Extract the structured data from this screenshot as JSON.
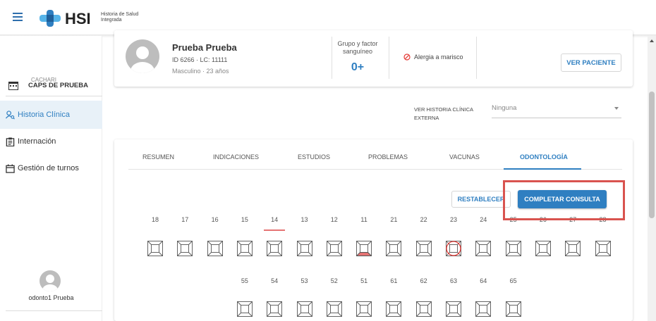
{
  "app": {
    "logo_text": "HSI",
    "logo_subtitle_line1": "Historia de Salud",
    "logo_subtitle_line2": "Integrada"
  },
  "sidebar": {
    "institution_name": "CAPS DE PRUEBA",
    "institution_location": "CACHARI",
    "items": [
      {
        "label": "Historia Clínica",
        "icon": "patient-search-icon",
        "active": true
      },
      {
        "label": "Internación",
        "icon": "clipboard-icon",
        "active": false
      },
      {
        "label": "Gestión de turnos",
        "icon": "calendar-icon",
        "active": false
      }
    ],
    "user_name": "odonto1 Prueba"
  },
  "patient": {
    "name": "Prueba Prueba",
    "ids": "ID 6266 · LC: 11111",
    "details": "Masculino · 23 años",
    "blood_label": "Grupo y factor sanguíneo",
    "blood_value": "0+",
    "allergy": "Alergia a marisco",
    "view_button": "VER PACIENTE"
  },
  "external_history": {
    "label_line1": "VER HISTORIA CLÍNICA",
    "label_line2": "EXTERNA",
    "selected": "Ninguna"
  },
  "tabs": [
    {
      "label": "RESUMEN",
      "active": false
    },
    {
      "label": "INDICACIONES",
      "active": false
    },
    {
      "label": "ESTUDIOS",
      "active": false
    },
    {
      "label": "PROBLEMAS",
      "active": false
    },
    {
      "label": "VACUNAS",
      "active": false
    },
    {
      "label": "ODONTOLOGÍA",
      "active": true
    }
  ],
  "odontogram": {
    "reset_button": "RESTABLECER",
    "complete_button": "COMPLETAR CONSULTA",
    "selected_tooth": "14",
    "permanent_teeth": [
      {
        "number": "18",
        "state": "none"
      },
      {
        "number": "17",
        "state": "none"
      },
      {
        "number": "16",
        "state": "none"
      },
      {
        "number": "15",
        "state": "none"
      },
      {
        "number": "14",
        "state": "none"
      },
      {
        "number": "13",
        "state": "none"
      },
      {
        "number": "12",
        "state": "none"
      },
      {
        "number": "11",
        "state": "bottom-red"
      },
      {
        "number": "21",
        "state": "none"
      },
      {
        "number": "22",
        "state": "none"
      },
      {
        "number": "23",
        "state": "circle-red"
      },
      {
        "number": "24",
        "state": "none"
      },
      {
        "number": "25",
        "state": "none"
      },
      {
        "number": "26",
        "state": "none"
      },
      {
        "number": "27",
        "state": "none"
      },
      {
        "number": "28",
        "state": "none"
      }
    ],
    "deciduous_teeth": [
      {
        "number": "55"
      },
      {
        "number": "54"
      },
      {
        "number": "53"
      },
      {
        "number": "52"
      },
      {
        "number": "51"
      },
      {
        "number": "61"
      },
      {
        "number": "62"
      },
      {
        "number": "63"
      },
      {
        "number": "64"
      },
      {
        "number": "65"
      }
    ]
  },
  "colors": {
    "primary": "#2f7fc1",
    "mark_red": "#e57373",
    "highlight": "#d9534f"
  }
}
